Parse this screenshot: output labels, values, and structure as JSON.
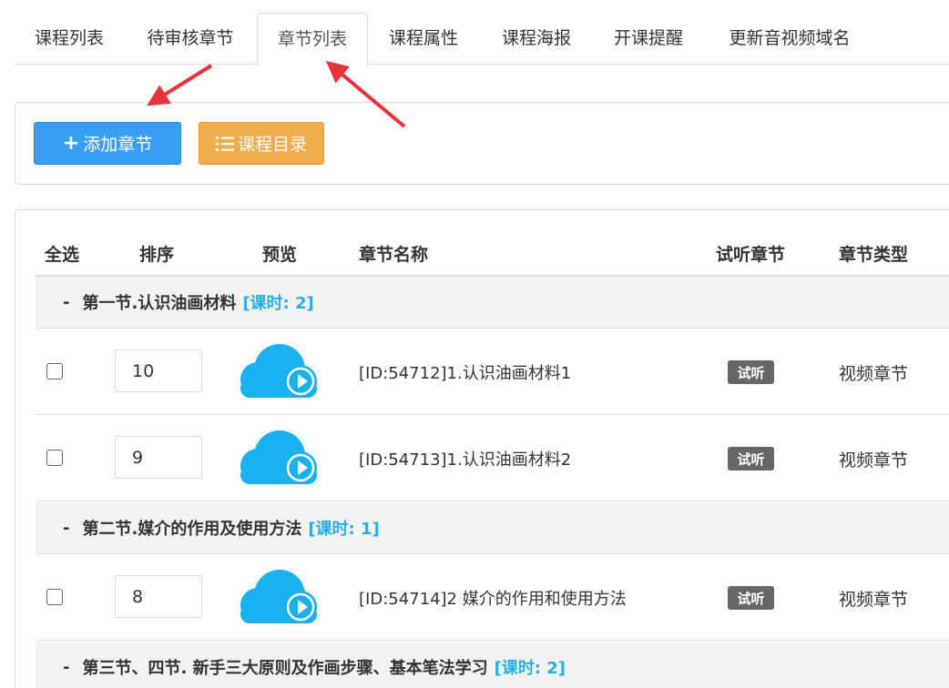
{
  "tabs": [
    {
      "label": "课程列表"
    },
    {
      "label": "待审核章节"
    },
    {
      "label": "章节列表",
      "active": true
    },
    {
      "label": "课程属性"
    },
    {
      "label": "课程海报"
    },
    {
      "label": "开课提醒"
    },
    {
      "label": "更新音视频域名"
    }
  ],
  "toolbar": {
    "add_chapter_label": "添加章节",
    "catalog_label": "课程目录",
    "add_icon": "plus-icon",
    "catalog_icon": "list-icon"
  },
  "table": {
    "headers": {
      "select_all": "全选",
      "sort": "排序",
      "preview": "预览",
      "chapter_name": "章节名称",
      "trial": "试听章节",
      "chapter_type": "章节类型"
    },
    "groups": [
      {
        "dash": "-",
        "title": "第一节.认识油画材料",
        "hours": "[课时: 2]",
        "rows": [
          {
            "sort": "10",
            "name": "[ID:54712]1.认识油画材料1",
            "trial": "试听",
            "type": "视频章节"
          },
          {
            "sort": "9",
            "name": "[ID:54713]1.认识油画材料2",
            "trial": "试听",
            "type": "视频章节"
          }
        ]
      },
      {
        "dash": "-",
        "title": "第二节.媒介的作用及使用方法",
        "hours": "[课时: 1]",
        "rows": [
          {
            "sort": "8",
            "name": "[ID:54714]2 媒介的作用和使用方法",
            "trial": "试听",
            "type": "视频章节"
          }
        ]
      },
      {
        "dash": "-",
        "title": "第三节、四节. 新手三大原则及作画步骤、基本笔法学习",
        "hours": "[课时: 2]",
        "rows": []
      }
    ]
  },
  "colors": {
    "primary": "#3b9ef5",
    "warning": "#f0ad4e",
    "cloud": "#1ab1f0",
    "hours": "#28aee8",
    "badge": "#666666",
    "arrow": "#e8323c"
  }
}
